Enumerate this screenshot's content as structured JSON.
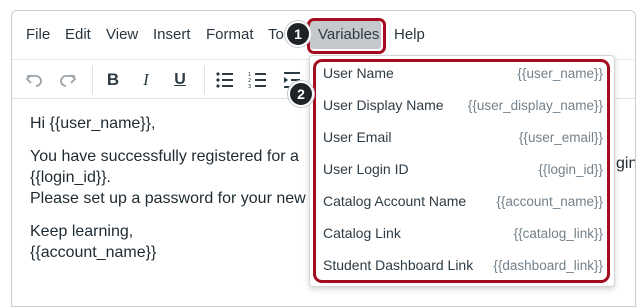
{
  "menubar": {
    "items": [
      "File",
      "Edit",
      "View",
      "Insert",
      "Format",
      "To",
      "Help"
    ],
    "active": "Variables"
  },
  "toolbar": {
    "buttons": [
      "undo-icon",
      "redo-icon",
      "bold-icon",
      "italic-icon",
      "underline-icon",
      "bullet-list-icon",
      "numbered-list-icon",
      "indent-icon"
    ],
    "bold": "B",
    "italic": "I",
    "underline": "U"
  },
  "content": {
    "line1": "Hi {{user_name}},",
    "line2": "You have successfully registered for a",
    "line2_tail": "gin",
    "line3": "{{login_id}}.",
    "line4": "Please set up a password for your new",
    "line5": "Keep learning,",
    "line6": "{{account_name}}"
  },
  "dropdown": {
    "items": [
      {
        "name": "User Name",
        "token": "{{user_name}}"
      },
      {
        "name": "User Display Name",
        "token": "{{user_display_name}}"
      },
      {
        "name": "User Email",
        "token": "{{user_email}}"
      },
      {
        "name": "User Login ID",
        "token": "{{login_id}}"
      },
      {
        "name": "Catalog Account Name",
        "token": "{{account_name}}"
      },
      {
        "name": "Catalog Link",
        "token": "{{catalog_link}}"
      },
      {
        "name": "Student Dashboard Link",
        "token": "{{dashboard_link}}"
      }
    ]
  },
  "callouts": {
    "step1": "1",
    "step2": "2"
  },
  "colors": {
    "highlight_outline": "#a30d1f",
    "menu_active_bg": "#c6c9cc",
    "callout_bg": "#1f2327"
  }
}
